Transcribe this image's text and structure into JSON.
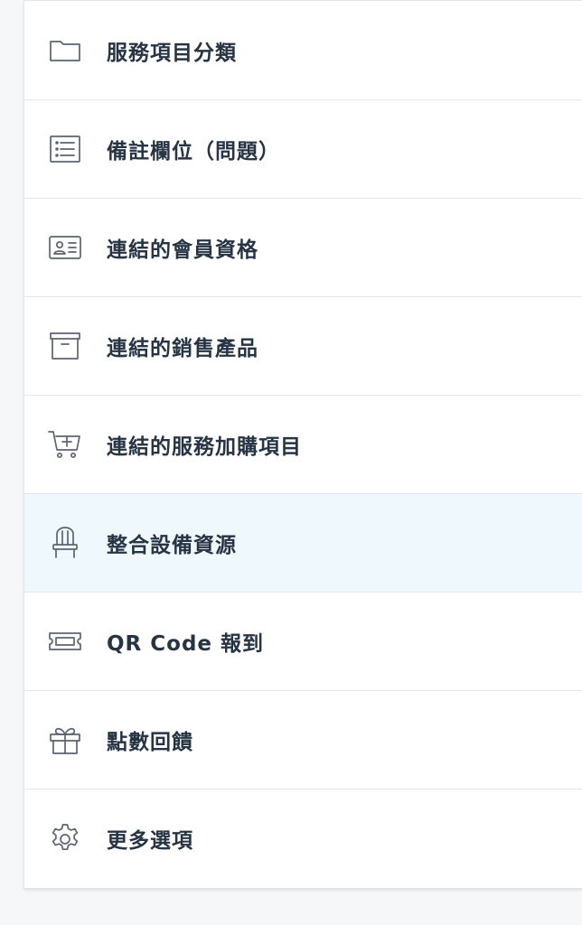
{
  "menu": {
    "items": [
      {
        "label": "服務項目分類",
        "icon": "folder-icon"
      },
      {
        "label": "備註欄位（問題）",
        "icon": "list-icon"
      },
      {
        "label": "連結的會員資格",
        "icon": "id-card-icon"
      },
      {
        "label": "連結的銷售產品",
        "icon": "archive-box-icon"
      },
      {
        "label": "連結的服務加購項目",
        "icon": "cart-plus-icon"
      },
      {
        "label": "整合設備資源",
        "icon": "chair-icon",
        "active": true
      },
      {
        "label": "QR Code 報到",
        "icon": "ticket-icon"
      },
      {
        "label": "點數回饋",
        "icon": "gift-icon"
      },
      {
        "label": "更多選項",
        "icon": "gear-icon"
      }
    ]
  },
  "colors": {
    "active_background": "#eff8fd",
    "label_text": "#273444",
    "icon_stroke": "#5b6470",
    "divider": "#e4e6ea"
  }
}
